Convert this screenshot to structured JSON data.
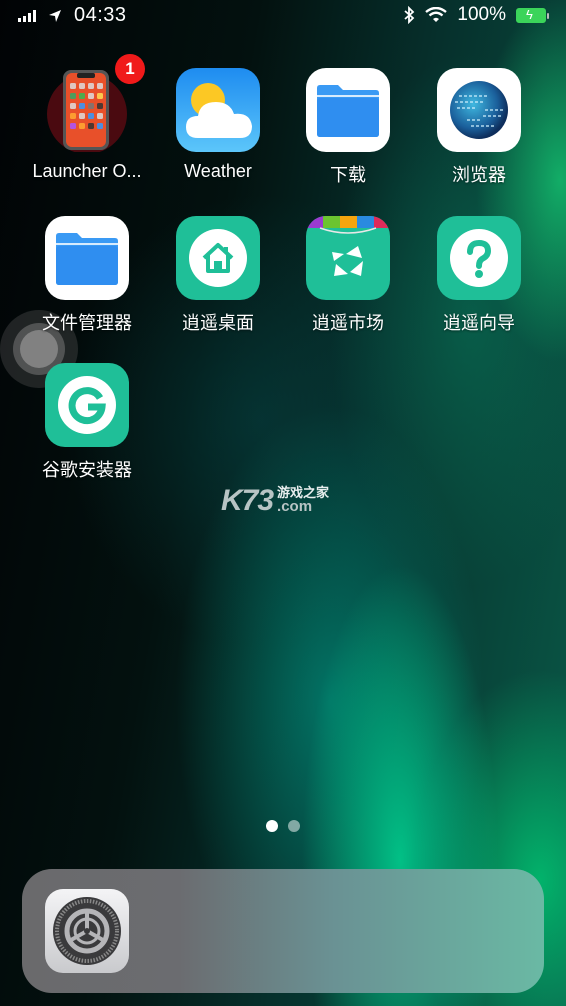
{
  "status_bar": {
    "time": "04:33",
    "battery_percent": "100%",
    "battery_level": 1.0,
    "signal_bars": 4,
    "icons": [
      "signal-icon",
      "location-arrow-icon",
      "bluetooth-icon",
      "wifi-icon",
      "battery-charging-icon"
    ]
  },
  "home": {
    "apps": [
      {
        "label": "Launcher O...",
        "icon": "launcher-phone-icon",
        "badge": "1"
      },
      {
        "label": "Weather",
        "icon": "weather-icon"
      },
      {
        "label": "下载",
        "icon": "folder-icon"
      },
      {
        "label": "浏览器",
        "icon": "globe-icon"
      },
      {
        "label": "文件管理器",
        "icon": "folder-icon"
      },
      {
        "label": "逍遥桌面",
        "icon": "home-icon"
      },
      {
        "label": "逍遥市场",
        "icon": "market-bag-icon"
      },
      {
        "label": "逍遥向导",
        "icon": "question-icon"
      },
      {
        "label": "谷歌安装器",
        "icon": "google-g-icon"
      }
    ],
    "page_indicator": {
      "current": 1,
      "total": 2
    }
  },
  "watermark": {
    "brand": "K73",
    "tagline": "游戏之家",
    "domain": ".com"
  },
  "dock": {
    "apps": [
      {
        "label": "Settings",
        "icon": "settings-gear-icon"
      }
    ]
  },
  "colors": {
    "accent_teal": "#1fbf98",
    "badge_red": "#f01a1a",
    "battery_green": "#3bd45a",
    "folder_blue": "#2f8ef0"
  }
}
